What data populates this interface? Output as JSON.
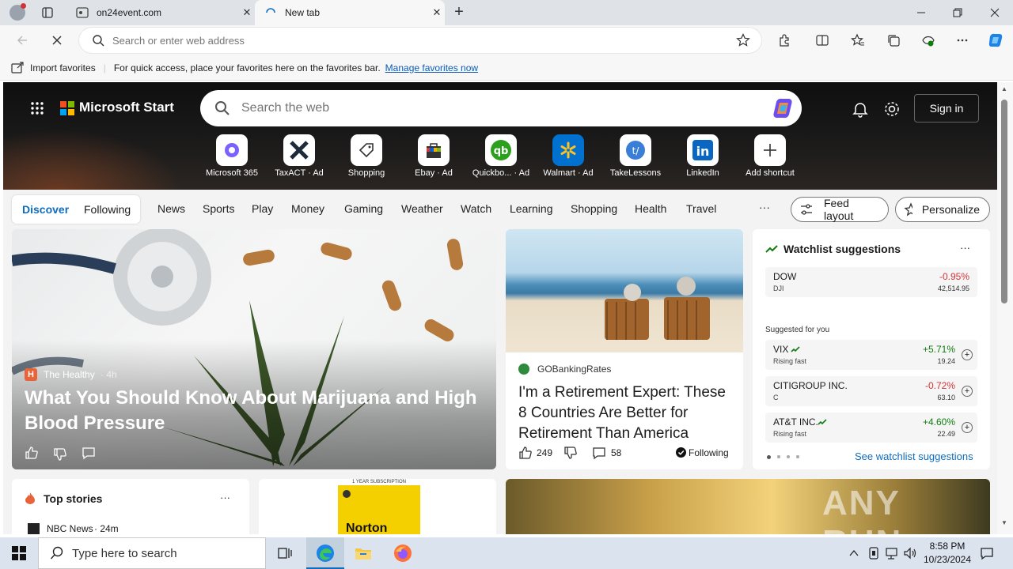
{
  "browser": {
    "tabs": [
      {
        "label": "on24event.com",
        "active": false
      },
      {
        "label": "New tab",
        "active": true
      }
    ],
    "address": {
      "placeholder": "Search or enter web address"
    },
    "favbar": {
      "import_label": "Import favorites",
      "hint": "For quick access, place your favorites here on the favorites bar.",
      "manage_link": "Manage favorites now"
    }
  },
  "msn": {
    "logo_text": "Microsoft Start",
    "search_placeholder": "Search the web",
    "signin": "Sign in",
    "shortcuts": [
      {
        "label": "Microsoft 365",
        "ad": ""
      },
      {
        "label": "TaxACT",
        "ad": "· Ad"
      },
      {
        "label": "Shopping",
        "ad": ""
      },
      {
        "label": "Ebay",
        "ad": "· Ad"
      },
      {
        "label": "Quickbo...",
        "ad": "· Ad"
      },
      {
        "label": "Walmart",
        "ad": "· Ad"
      },
      {
        "label": "TakeLessons",
        "ad": ""
      },
      {
        "label": "LinkedIn",
        "ad": ""
      },
      {
        "label": "Add shortcut",
        "ad": ""
      }
    ],
    "nav": {
      "pill": [
        "Discover",
        "Following"
      ],
      "items": [
        "News",
        "Sports",
        "Play",
        "Money",
        "Gaming",
        "Weather",
        "Watch",
        "Learning",
        "Shopping",
        "Health",
        "Travel"
      ],
      "more": "···",
      "feed_layout": "Feed layout",
      "personalize": "Personalize"
    },
    "featured": {
      "source": "The Healthy",
      "age": "· 4h",
      "title": "What You Should Know About Marijuana and High Blood Pressure"
    },
    "retire": {
      "source": "GOBankingRates",
      "title": "I'm a Retirement Expert: These 8 Countries Are Better for Retirement Than America",
      "likes": "249",
      "comments": "58",
      "following": "Following"
    },
    "watchlist": {
      "title": "Watchlist suggestions",
      "more": "···",
      "dow": {
        "name": "DOW",
        "sub": "DJI",
        "pct": "-0.95%",
        "price": "42,514.95"
      },
      "suggested_label": "Suggested for you",
      "rows": [
        {
          "name": "VIX",
          "sub": "Rising fast",
          "pct": "+5.71%",
          "price": "19.24",
          "up": true
        },
        {
          "name": "CITIGROUP INC.",
          "sub": "C",
          "pct": "-0.72%",
          "price": "63.10",
          "up": false
        },
        {
          "name": "AT&T INC.",
          "sub": "Rising fast",
          "pct": "+4.60%",
          "price": "22.49",
          "up": true
        }
      ],
      "see_more": "See watchlist suggestions"
    },
    "top_stories": {
      "title": "Top stories",
      "more": "···",
      "first_source": "NBC News",
      "first_age": "· 24m"
    },
    "ad_card": {
      "brand": "Norton",
      "badge": "1 YEAR SUBSCRIPTION"
    }
  },
  "watermark": "ANY RUN",
  "taskbar": {
    "search_placeholder": "Type here to search",
    "time": "8:58 PM",
    "date": "10/23/2024"
  }
}
